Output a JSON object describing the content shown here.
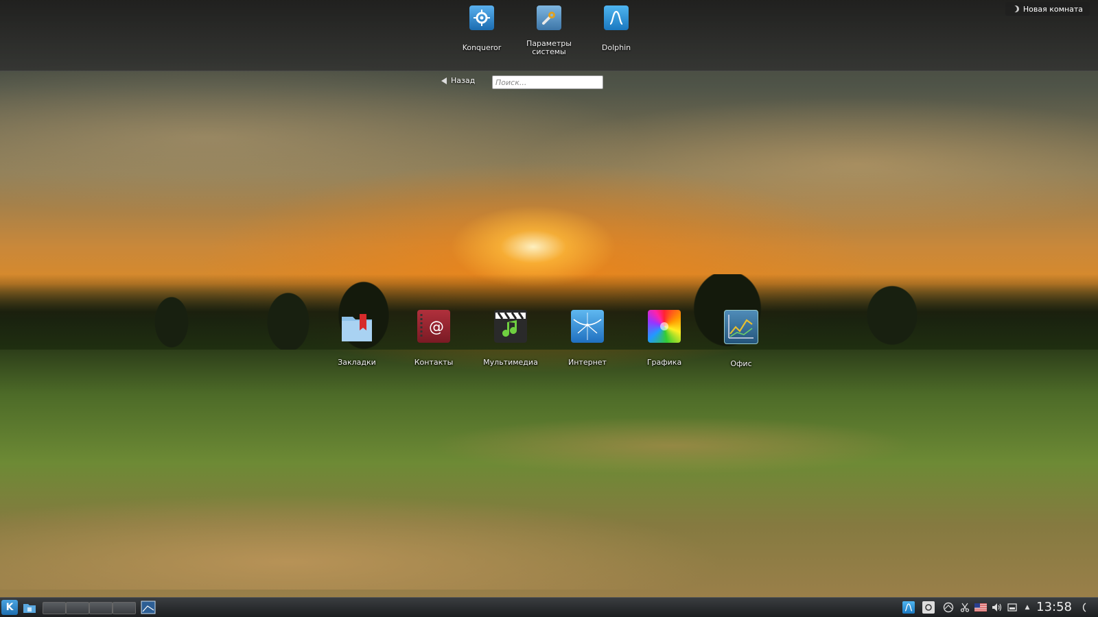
{
  "favorites": [
    {
      "label": "Konqueror",
      "icon": "konqueror-icon"
    },
    {
      "label": "Параметры системы",
      "icon": "system-settings-icon"
    },
    {
      "label": "Dolphin",
      "icon": "dolphin-icon"
    }
  ],
  "activity": {
    "label": "Новая комната",
    "icon": "activity-moon-icon"
  },
  "navigation": {
    "back_label": "Назад",
    "search_placeholder": "Поиск..."
  },
  "categories": [
    {
      "label": "Закладки",
      "icon": "bookmarks-folder-icon"
    },
    {
      "label": "Контакты",
      "icon": "contacts-book-icon"
    },
    {
      "label": "Мультимедиа",
      "icon": "multimedia-clapper-icon"
    },
    {
      "label": "Интернет",
      "icon": "internet-globe-icon"
    },
    {
      "label": "Графика",
      "icon": "graphics-color-wheel-icon"
    },
    {
      "label": "Офис",
      "icon": "office-chart-icon"
    }
  ],
  "taskbar": {
    "launcher_label": "K",
    "clock": "13:58"
  },
  "colors": {
    "accent": "#2f8fd8",
    "panel": "#2a2a2a"
  }
}
